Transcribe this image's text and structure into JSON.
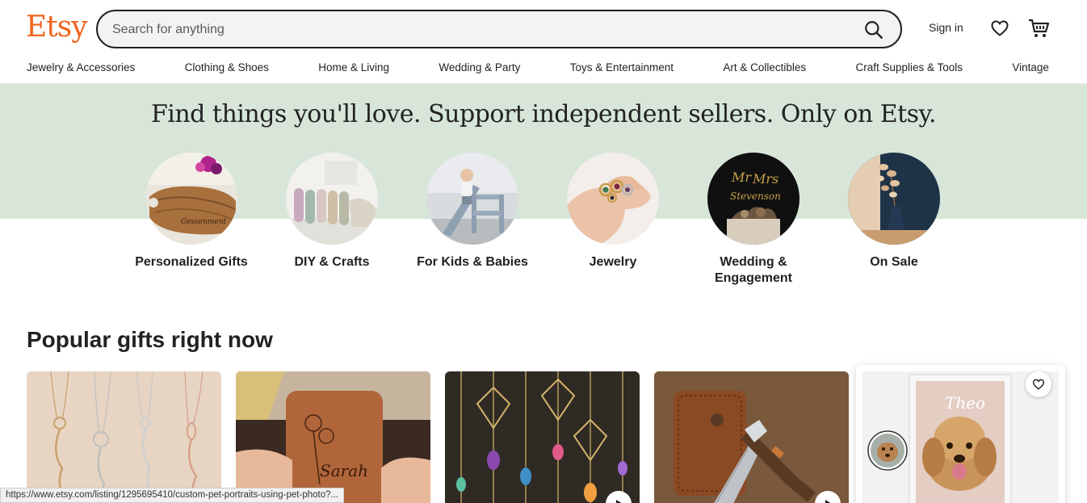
{
  "header": {
    "logo": "Etsy",
    "search_placeholder": "Search for anything",
    "signin_label": "Sign in",
    "accent_color": "#f1641e"
  },
  "nav": [
    "Jewelry & Accessories",
    "Clothing & Shoes",
    "Home & Living",
    "Wedding & Party",
    "Toys & Entertainment",
    "Art & Collectibles",
    "Craft Supplies & Tools",
    "Vintage"
  ],
  "hero": {
    "title": "Find things you'll love. Support independent sellers. Only on Etsy.",
    "background": "#d7e6d9"
  },
  "categories": [
    {
      "label": "Personalized Gifts",
      "image": "engraved-wood-board-image"
    },
    {
      "label": "DIY & Crafts",
      "image": "fabric-rolls-image"
    },
    {
      "label": "For Kids & Babies",
      "image": "child-climbing-toy-image"
    },
    {
      "label": "Jewelry",
      "image": "gemstone-rings-image"
    },
    {
      "label": "Wedding & Engagement",
      "image": "mr-mrs-cake-topper-image"
    },
    {
      "label": "On Sale",
      "image": "dried-flowers-vase-image"
    }
  ],
  "popular": {
    "title": "Popular gifts right now",
    "items": [
      {
        "image": "birth-flower-name-necklaces-image"
      },
      {
        "image": "leather-jewelry-box-sarah-image",
        "engraving": "Sarah"
      },
      {
        "image": "crystal-suncatchers-image"
      },
      {
        "image": "damascus-pocket-knife-image"
      },
      {
        "image": "custom-pet-portrait-image",
        "portrait_name": "Theo"
      }
    ]
  },
  "status_bar": {
    "url": "https://www.etsy.com/listing/1295695410/custom-pet-portraits-using-pet-photo?..."
  }
}
